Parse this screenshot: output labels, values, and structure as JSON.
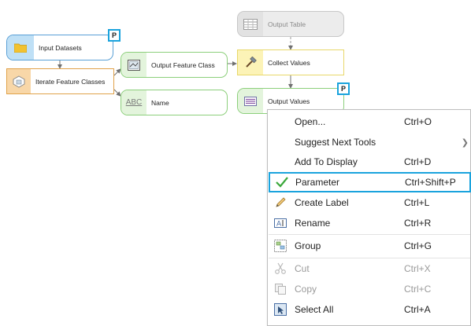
{
  "nodes": {
    "input_datasets": "Input Datasets",
    "iterate_feature_classes": "Iterate Feature Classes",
    "output_feature_class": "Output Feature Class",
    "name": "Name",
    "collect_values": "Collect Values",
    "output_table": "Output Table",
    "output_values": "Output Values",
    "name_icon_text": "ABC"
  },
  "param_marker": "P",
  "menu": {
    "items": [
      {
        "label": "Open...",
        "shortcut": "Ctrl+O",
        "icon": "none",
        "enabled": true
      },
      {
        "label": "Suggest Next Tools",
        "shortcut": "",
        "icon": "none",
        "enabled": true,
        "submenu": true
      },
      {
        "label": "Add To Display",
        "shortcut": "Ctrl+D",
        "icon": "none",
        "enabled": true
      },
      {
        "label": "Parameter",
        "shortcut": "Ctrl+Shift+P",
        "icon": "checkmark-icon",
        "enabled": true,
        "checked": true
      },
      {
        "label": "Create Label",
        "shortcut": "Ctrl+L",
        "icon": "pencil-label-icon",
        "enabled": true
      },
      {
        "label": "Rename",
        "shortcut": "Ctrl+R",
        "icon": "rename-icon",
        "enabled": true
      },
      {
        "label": "Group",
        "shortcut": "Ctrl+G",
        "icon": "group-icon",
        "enabled": true
      },
      {
        "label": "Cut",
        "shortcut": "Ctrl+X",
        "icon": "scissors-icon",
        "enabled": false
      },
      {
        "label": "Copy",
        "shortcut": "Ctrl+C",
        "icon": "copy-icon",
        "enabled": false
      },
      {
        "label": "Select All",
        "shortcut": "Ctrl+A",
        "icon": "select-all-icon",
        "enabled": true
      }
    ]
  },
  "colors": {
    "highlight": "#1aa3dd",
    "check": "#3aa83a"
  }
}
